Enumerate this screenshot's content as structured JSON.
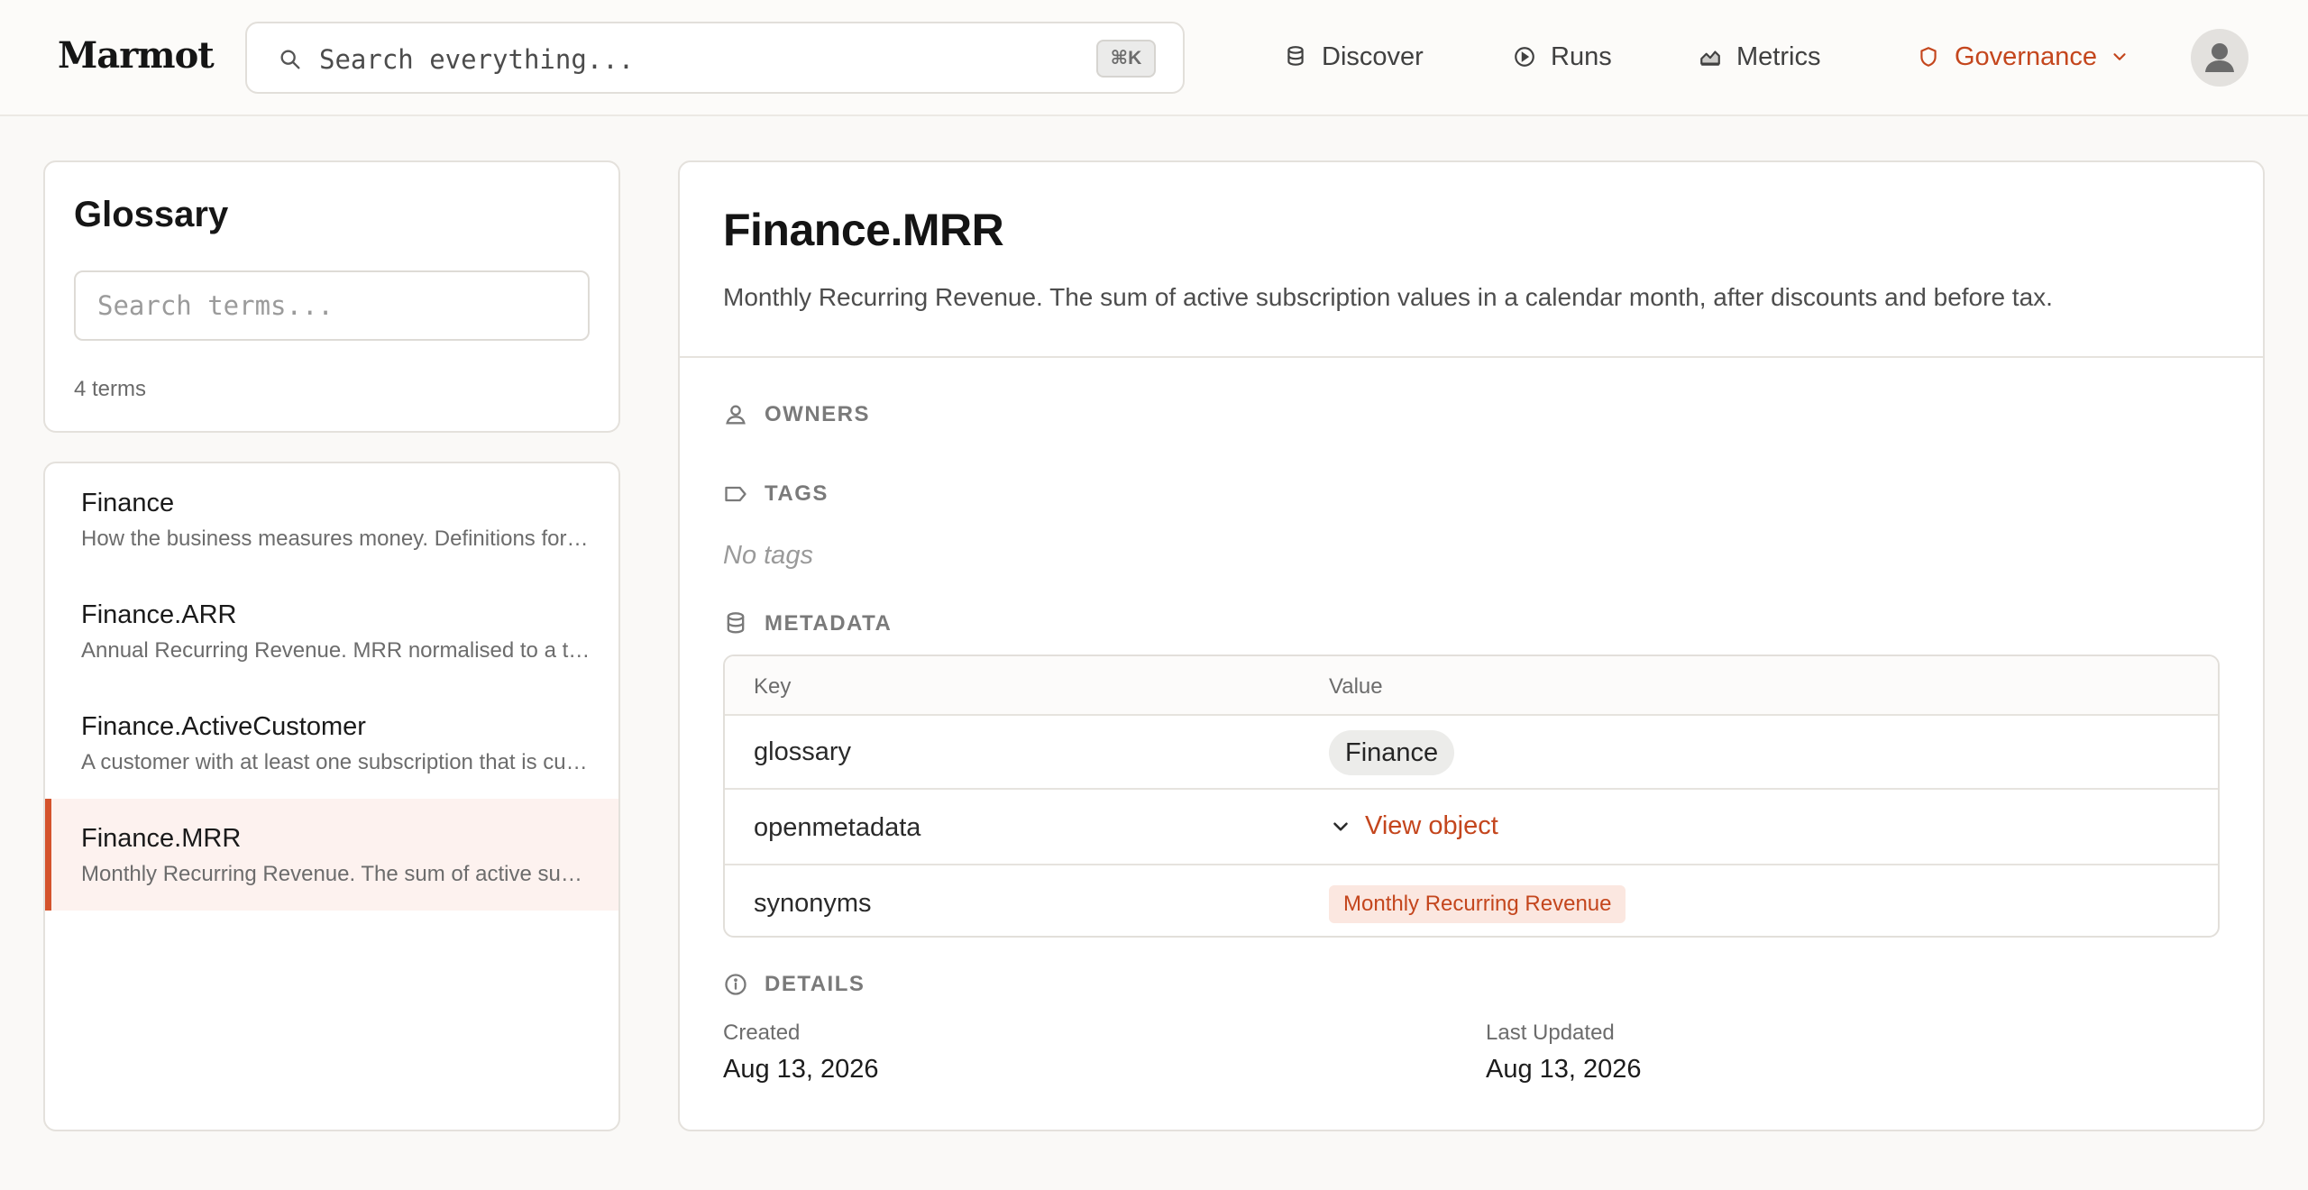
{
  "app": {
    "logo": "Marmot",
    "search_placeholder": "Search everything...",
    "search_shortcut": "⌘K"
  },
  "nav": {
    "discover": "Discover",
    "runs": "Runs",
    "metrics": "Metrics",
    "governance": "Governance",
    "active": "Governance",
    "accent_color": "#c4461d"
  },
  "glossary": {
    "title": "Glossary",
    "search_placeholder": "Search terms...",
    "count_text": "4 terms",
    "terms": [
      {
        "name": "Finance",
        "desc": "How the business measures money. Definitions for revenue, churn and customer metrics."
      },
      {
        "name": "Finance.ARR",
        "desc": "Annual Recurring Revenue. MRR normalised to a twelve month period."
      },
      {
        "name": "Finance.ActiveCustomer",
        "desc": "A customer with at least one subscription that is currently active."
      },
      {
        "name": "Finance.MRR",
        "desc": "Monthly Recurring Revenue. The sum of active subscription values in a calendar month."
      }
    ],
    "selected": "Finance.MRR"
  },
  "detail": {
    "title": "Finance.MRR",
    "description": "Monthly Recurring Revenue. The sum of active subscription values in a calendar month, after discounts and before tax.",
    "owners_label": "OWNERS",
    "tags_label": "TAGS",
    "no_tags": "No tags",
    "metadata_label": "METADATA",
    "metadata": {
      "key_header": "Key",
      "value_header": "Value",
      "rows": [
        {
          "key": "glossary",
          "value": "Finance"
        },
        {
          "key": "openmetadata",
          "value": "View object"
        },
        {
          "key": "synonyms",
          "value": "Monthly Recurring Revenue"
        }
      ]
    },
    "details_label": "DETAILS",
    "created_label": "Created",
    "created": "Aug 13, 2026",
    "updated_label": "Last Updated",
    "updated": "Aug 13, 2026"
  }
}
